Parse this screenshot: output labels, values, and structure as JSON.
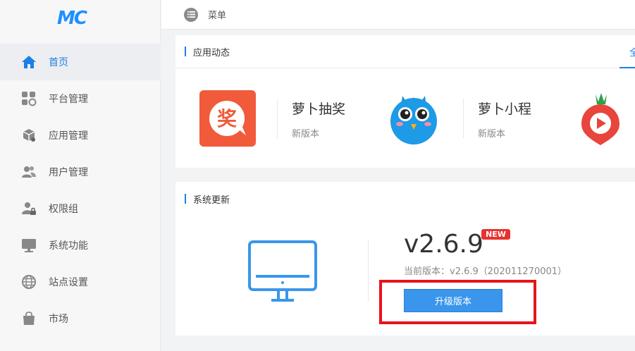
{
  "logo": {
    "text": "MC"
  },
  "sidebar": {
    "items": [
      {
        "label": "首页",
        "icon": "home-icon",
        "active": true
      },
      {
        "label": "平台管理",
        "icon": "platform-icon"
      },
      {
        "label": "应用管理",
        "icon": "cube-icon"
      },
      {
        "label": "用户管理",
        "icon": "users-icon"
      },
      {
        "label": "权限组",
        "icon": "lock-user-icon"
      },
      {
        "label": "系统功能",
        "icon": "monitor-icon"
      },
      {
        "label": "站点设置",
        "icon": "globe-icon"
      },
      {
        "label": "市场",
        "icon": "shopping-bag-icon"
      }
    ]
  },
  "topbar": {
    "menu_label": "菜单"
  },
  "apps_section": {
    "title": "应用动态",
    "more_label": "全",
    "apps": [
      {
        "name": "萝卜抽奖",
        "version": "新版本",
        "icon": "lottery-app-icon"
      },
      {
        "name": "萝卜小程",
        "version": "新版本",
        "icon": "blue-bird-app-icon"
      },
      {
        "name": "",
        "version": "",
        "icon": "radish-play-app-icon"
      }
    ]
  },
  "update_section": {
    "title": "系统更新",
    "version": "v2.6.9",
    "new_badge": "NEW",
    "current_version": "当前版本：v2.6.9（202011270001）",
    "upgrade_button": "升级版本"
  },
  "colors": {
    "accent": "#1e7fe6",
    "badge": "#e8322f",
    "highlight": "#e6141a"
  }
}
